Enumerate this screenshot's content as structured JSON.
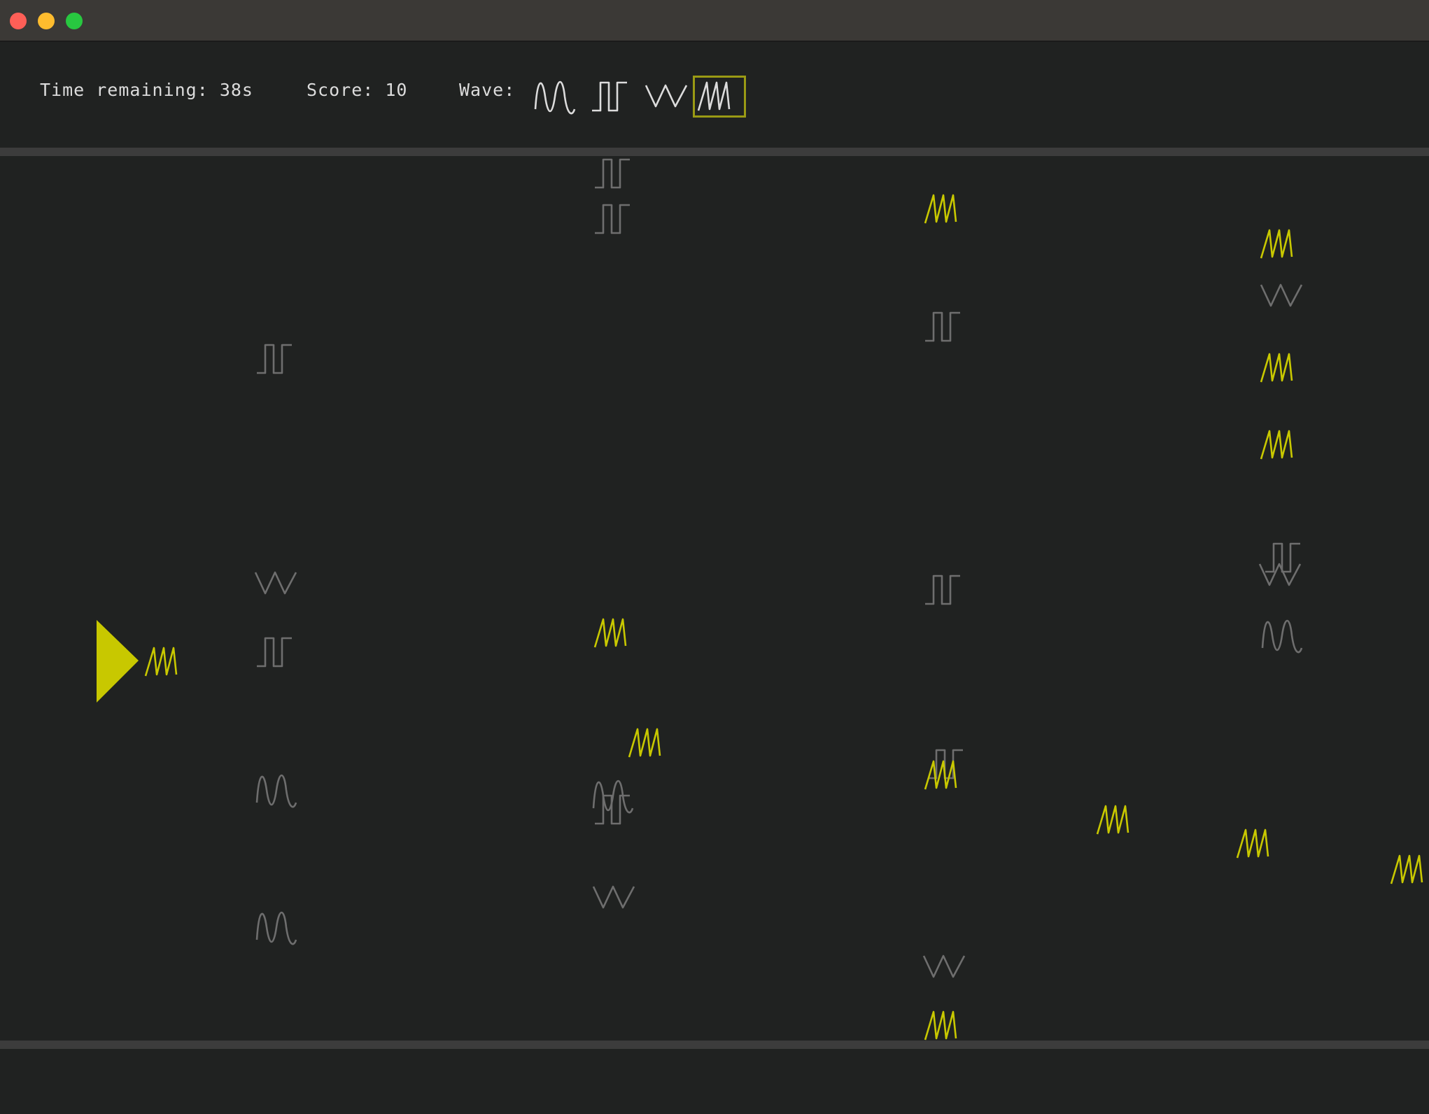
{
  "hud": {
    "time_label": "Time remaining: 38s",
    "score_label": "Score: 10",
    "wave_label": "Wave:",
    "wave_options": [
      {
        "kind": "sine",
        "icon": "sine-wave-icon",
        "selected": false
      },
      {
        "kind": "square",
        "icon": "square-wave-icon",
        "selected": false
      },
      {
        "kind": "triangle",
        "icon": "triangle-wave-icon",
        "selected": false
      },
      {
        "kind": "sawtooth",
        "icon": "sawtooth-wave-icon",
        "selected": true
      }
    ]
  },
  "colors": {
    "background": "#202221",
    "titlebar": "#3b3936",
    "rail": "#3c3c3c",
    "text": "#dcdcdc",
    "player": "#c8c800",
    "match_wave": "#c8c800",
    "other_wave": "#6e6e6e",
    "selected_border": "#9a9a14"
  },
  "player": {
    "icon": "player-triangle-icon",
    "projectile_wave": "sawtooth"
  }
}
